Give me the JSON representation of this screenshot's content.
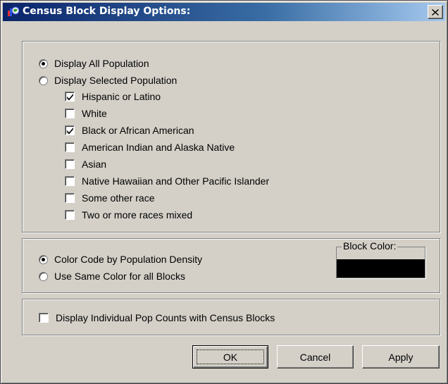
{
  "window": {
    "title": "Census Block Display Options:",
    "app_icon": "census-app-icon",
    "close_label": "×"
  },
  "population": {
    "display_all_label": "Display All Population",
    "display_selected_label": "Display Selected Population",
    "selected_mode": "all",
    "races": [
      {
        "label": "Hispanic or Latino",
        "checked": true
      },
      {
        "label": "White",
        "checked": false
      },
      {
        "label": "Black or African American",
        "checked": true
      },
      {
        "label": "American Indian and Alaska Native",
        "checked": false
      },
      {
        "label": "Asian",
        "checked": false
      },
      {
        "label": "Native Hawaiian and Other Pacific Islander",
        "checked": false
      },
      {
        "label": "Some other race",
        "checked": false
      },
      {
        "label": "Two or more races mixed",
        "checked": false
      }
    ]
  },
  "color": {
    "color_code_label": "Color Code by Population Density",
    "same_color_label": "Use Same Color for all Blocks",
    "selected_mode": "density",
    "block_color_label": "Block Color:",
    "block_color_value": "#000000"
  },
  "counts": {
    "display_counts_label": "Display Individual Pop Counts with Census Blocks",
    "checked": false
  },
  "buttons": {
    "ok_label": "OK",
    "cancel_label": "Cancel",
    "apply_label": "Apply"
  },
  "colors": {
    "face": "#d4d0c8",
    "title_start": "#0a246a",
    "title_end": "#a6caf0"
  }
}
